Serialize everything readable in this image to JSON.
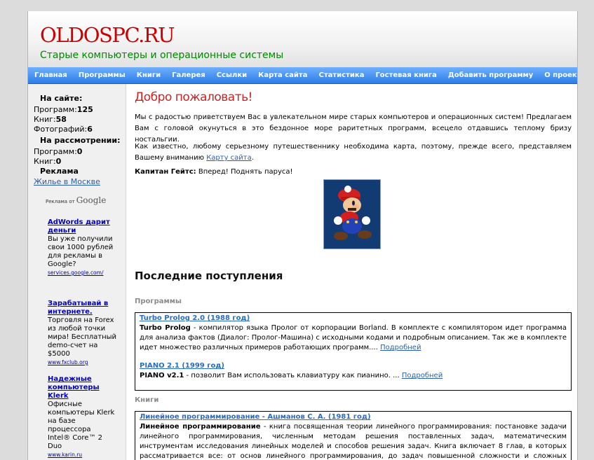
{
  "header": {
    "title": "OLDOSPC.RU",
    "subtitle": "Старые компьютеры и операционные системы"
  },
  "nav": {
    "items": [
      "Главная",
      "Программы",
      "Книги",
      "Галерея",
      "Ссылки",
      "Карта сайта",
      "Статистика",
      "Гостевая книга",
      "Добавить программу",
      "О проекте"
    ]
  },
  "sidebar": {
    "on_site_heading": "На сайте:",
    "programs_label": "Программ:",
    "programs_count": "125",
    "books_label": "Книг:",
    "books_count": "58",
    "photos_label": "Фотографий:",
    "photos_count": "6",
    "review_heading": "На рассмотрении:",
    "review_programs_label": "Программ:",
    "review_programs_count": "0",
    "review_books_label": "Книг:",
    "review_books_count": "0",
    "ads_heading": "Реклама",
    "ads_link": "Жилье в Москве",
    "google_label": "Реклама от",
    "google_logo": "Google",
    "ads": [
      {
        "title_lines": [
          "AdWords дарит",
          "деньги"
        ],
        "text_lines": [
          "Вы уже получили",
          "свои 1000 рублей",
          "для рекламы в",
          "Google?"
        ],
        "url": "services.google.com/"
      },
      {
        "title_lines": [
          "Зарабатывай в",
          "интернете."
        ],
        "text_lines": [
          "Торговля на Forex",
          "из любой точки",
          "мира! Бесплатный",
          "demo-счет на $5000"
        ],
        "url": "www.fxclub.org"
      },
      {
        "title_lines": [
          "Надежные",
          "компьютеры",
          "Klerk"
        ],
        "text_lines": [
          "Офисные",
          "компьютеры Klerk",
          "на базе процессора",
          "Intel® Core™ 2 Duo"
        ],
        "url": "www.karin.ru"
      }
    ]
  },
  "main": {
    "welcome_title": "Добро пожаловать!",
    "intro": "Мы с радостью приветствуем Вас в увлекательном мире старых компьютеров и операционных систем! Предлагаем Вам с головой окунуться в это бездонное море раритетных программ, всецело отдавшись теплому бризу ностальгии.",
    "map_text": "Как известно, любому серьезному путешественнику необходима карта, поэтому, прежде всего, представляем Вашему вниманию",
    "map_link": "Карту сайта",
    "map_end": ".",
    "captain_name": "Капитан Гейтс:",
    "captain_quote": " Вперед! Поднять паруса!",
    "latest_heading": "Последние поступления",
    "programs_category": "Программы",
    "books_category": "Книги",
    "program_items": [
      {
        "title": "Turbo Prolog 2.0 (1988 год)",
        "name": "Turbo Prolog",
        "desc": " - компилятор языка Пролог от корпорации Borland. В комплекте с компилятором идет программа для анализа фактов (Диалог: Пролог-Машина) с исходными кодами и подробным описанием. Так же в комплекте идет множество различных примеров работающих программ....",
        "more": "Подробней"
      },
      {
        "title": "PIANO 2.1 (1999 год)",
        "name": "PIANO v2.1",
        "desc": " - позволит Вам использовать клавиатуру как пианино. ... ",
        "more": "Подробней"
      }
    ],
    "book_items": [
      {
        "title": "Линейное программирование - Ашманов С. А. (1981 год)",
        "name": "Линейное программирование",
        "desc": " - книга посвященная теории линейного программирования: постановке задачи линейного программирования, численным методам решения поставленных задач, математическим инструментам исследования линейных моделей и способов решения задач. Книга включает 8 глав, в которых рассматривается все: от основ линейного программирования, до задач повышенной сложности и сложных математических методов. В книге дается ряд упражнений, а так же подробный разбор их решения. Все представленные в книге алгоритмы математических"
      }
    ]
  },
  "colors": {
    "brand_red": "#cc0000",
    "subtitle_green": "#008800",
    "nav_blue": "#2c7ce8",
    "link_blue": "#2a6cc4"
  },
  "icons": [
    "mario-image"
  ]
}
